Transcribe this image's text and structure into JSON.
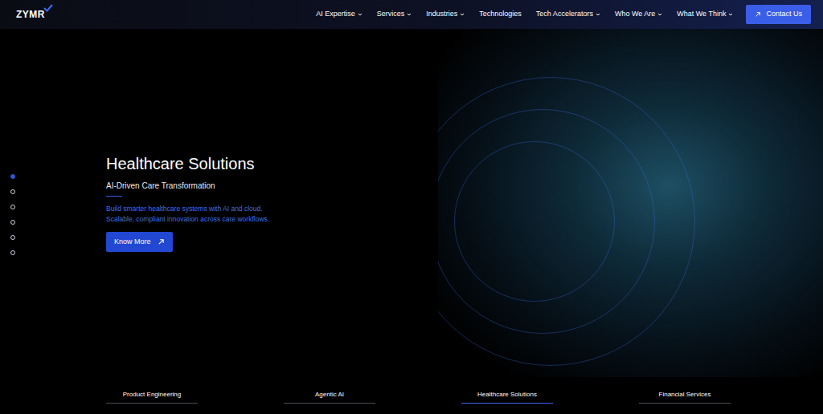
{
  "logo": {
    "text": "ZYMR"
  },
  "nav": {
    "items": [
      {
        "label": "AI Expertise",
        "has_menu": true
      },
      {
        "label": "Services",
        "has_menu": true
      },
      {
        "label": "Industries",
        "has_menu": true
      },
      {
        "label": "Technologies",
        "has_menu": false
      },
      {
        "label": "Tech Accelerators",
        "has_menu": true
      },
      {
        "label": "Who We Are",
        "has_menu": true
      },
      {
        "label": "What We Think",
        "has_menu": true
      }
    ]
  },
  "contact_button": {
    "label": "Contact Us"
  },
  "slider_dots": [
    {
      "selected": true
    },
    {
      "selected": false
    },
    {
      "selected": false
    },
    {
      "selected": false
    },
    {
      "selected": false
    },
    {
      "selected": false
    }
  ],
  "hero": {
    "title": "Healthcare Solutions",
    "subtitle": "AI-Driven Care Transformation",
    "description": [
      "Build smarter healthcare systems with AI and cloud.",
      "Scalable, compliant innovation across care workflows."
    ],
    "button": "Know More"
  },
  "tabs": [
    {
      "label": "Product Engineering",
      "selected": false
    },
    {
      "label": "Agentic AI",
      "selected": false
    },
    {
      "label": "Healthcare Solutions",
      "selected": true
    },
    {
      "label": "Financial Services",
      "selected": false
    }
  ]
}
